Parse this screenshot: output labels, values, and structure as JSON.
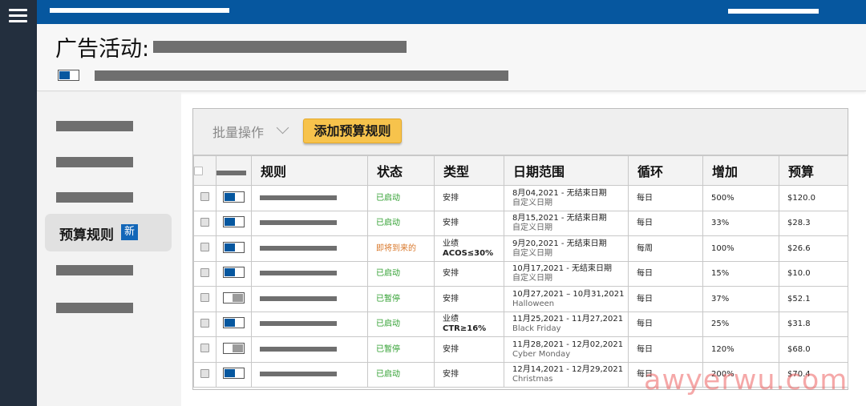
{
  "header": {
    "title": "广告活动:"
  },
  "sidenav": {
    "active_item": {
      "label": "预算规则",
      "badge": "新"
    }
  },
  "toolbar": {
    "bulk_label": "批量操作",
    "add_button_label": "添加预算规则"
  },
  "table": {
    "columns": [
      "规则",
      "状态",
      "类型",
      "日期范围",
      "循环",
      "增加",
      "预算"
    ],
    "rows": [
      {
        "toggle": "on",
        "status": "已启动",
        "status_kind": "active",
        "type": "安排",
        "type2": "",
        "date": "8月04,2021 - 无结束日期",
        "date_sub": "自定义日期",
        "cycle": "每日",
        "increase": "500%",
        "budget": "$120.0"
      },
      {
        "toggle": "on",
        "status": "已启动",
        "status_kind": "active",
        "type": "安排",
        "type2": "",
        "date": "8月15,2021 - 无结束日期",
        "date_sub": "自定义日期",
        "cycle": "每日",
        "increase": "33%",
        "budget": "$28.3"
      },
      {
        "toggle": "on",
        "status": "即将到来的",
        "status_kind": "upcoming",
        "type": "业绩",
        "type2": "ACOS≤30%",
        "date": "9月20,2021 - 无结束日期",
        "date_sub": "自定义日期",
        "cycle": "每周",
        "increase": "100%",
        "budget": "$26.6"
      },
      {
        "toggle": "on",
        "status": "已启动",
        "status_kind": "active",
        "type": "安排",
        "type2": "",
        "date": "10月17,2021 - 无结束日期",
        "date_sub": "自定义日期",
        "cycle": "每日",
        "increase": "15%",
        "budget": "$10.0"
      },
      {
        "toggle": "off",
        "status": "已暂停",
        "status_kind": "paused",
        "type": "安排",
        "type2": "",
        "date": "10月27,2021 – 10月31,2021",
        "date_sub": "Halloween",
        "cycle": "每日",
        "increase": "37%",
        "budget": "$52.1"
      },
      {
        "toggle": "on",
        "status": "已启动",
        "status_kind": "active",
        "type": "业绩",
        "type2": "CTR≥16%",
        "date": "11月25,2021 - 11月27,2021",
        "date_sub": "Black Friday",
        "cycle": "每日",
        "increase": "25%",
        "budget": "$31.8"
      },
      {
        "toggle": "off",
        "status": "已暂停",
        "status_kind": "paused",
        "type": "安排",
        "type2": "",
        "date": "11月28,2021 - 12月02,2021",
        "date_sub": "Cyber Monday",
        "cycle": "每日",
        "increase": "120%",
        "budget": "$68.0"
      },
      {
        "toggle": "on",
        "status": "已启动",
        "status_kind": "active",
        "type": "安排",
        "type2": "",
        "date": "12月14,2021 - 12月29,2021",
        "date_sub": "Christmas",
        "cycle": "每日",
        "increase": "200%",
        "budget": "$70.4"
      }
    ]
  },
  "watermark": "awyerwu.com",
  "colors": {
    "topbar": "#06579f",
    "rail": "#232f3e",
    "accent_button": "#f7c34c",
    "status_active": "#2e9e2e",
    "status_upcoming": "#d9782b"
  }
}
